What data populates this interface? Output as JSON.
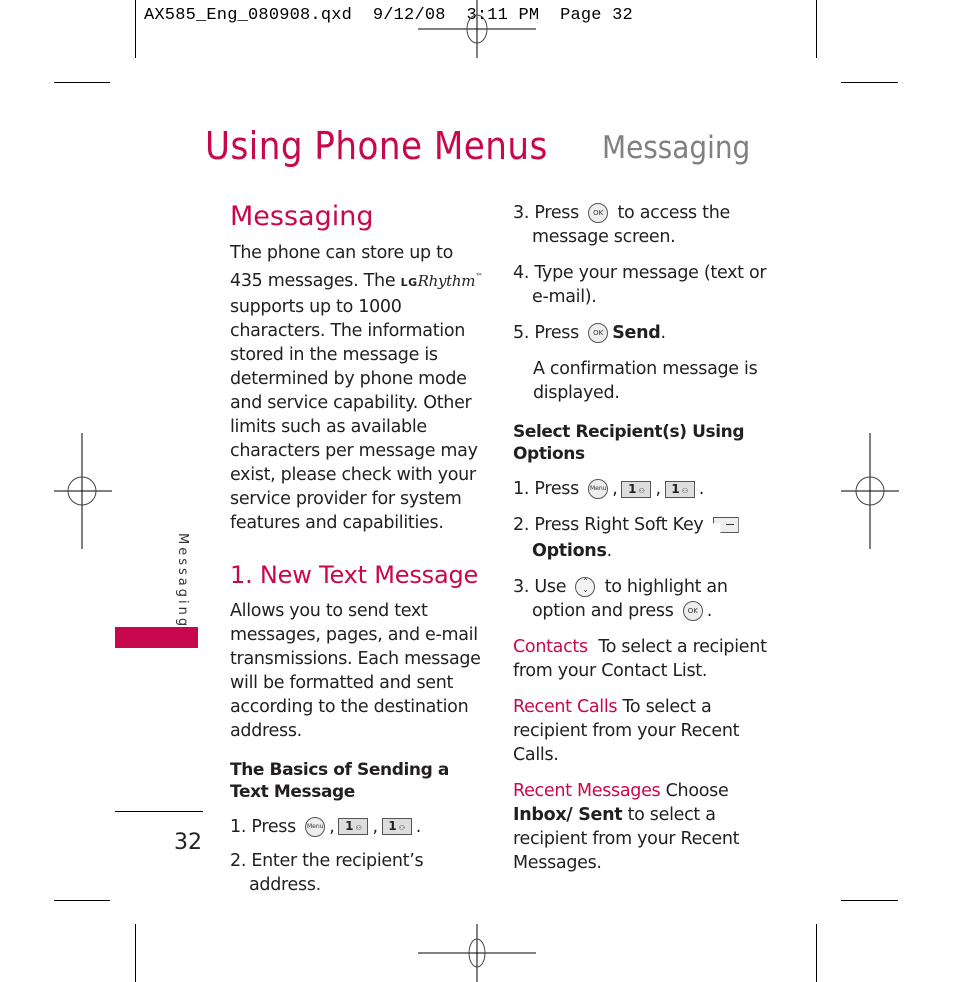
{
  "slug": "AX585_Eng_080908.qxd  9/12/08  3:11 PM  Page 32",
  "header": {
    "title": "Using Phone Menus",
    "subtitle": "Messaging"
  },
  "sidebar": {
    "label": "Messaging",
    "accent_color": "#c8084c"
  },
  "page_number": "32",
  "left_column": {
    "heading": "Messaging",
    "intro_part1": "The phone can store up to 435 messages. The",
    "brand_lg": "LG",
    "brand_name": "Rhythm",
    "brand_tm": "™",
    "intro_part2": "supports up to 1000 characters. The information stored in the message is determined by phone mode and service capability. Other limits such as available characters per message may exist, please check with your service provider for system features and capabilities.",
    "section_heading": "1. New Text Message",
    "section_text": "Allows you to send text messages, pages, and e-mail transmissions. Each message will be formatted and sent according to the destination address.",
    "basics_heading": "The Basics of Sending a Text Message",
    "steps": [
      {
        "num": "1.",
        "text": "Press",
        "keys": [
          "Menu",
          "1",
          "1"
        ],
        "end": "."
      },
      {
        "num": "2.",
        "text": "Enter the recipient’s address."
      }
    ]
  },
  "right_column": {
    "steps": [
      {
        "num": "3.",
        "before": "Press",
        "key": "OK",
        "after": "to access the message screen."
      },
      {
        "num": "4.",
        "text": "Type your message (text or e-mail)."
      },
      {
        "num": "5.",
        "before": "Press",
        "key": "OK",
        "bold": "Send",
        "after": "."
      }
    ],
    "confirmation": "A confirmation message is displayed.",
    "recipient_heading": "Select Recipient(s) Using Options",
    "recipient_steps": [
      {
        "num": "1.",
        "text": "Press",
        "keys": [
          "Menu",
          "1",
          "1"
        ],
        "end": "."
      },
      {
        "num": "2.",
        "text": "Press Right Soft Key",
        "bold": "Options",
        "end": "."
      },
      {
        "num": "3.",
        "before": "Use",
        "after": "to highlight an option and press",
        "key": "OK",
        "end": "."
      }
    ],
    "options": [
      {
        "label": "Contacts",
        "text": "To select a recipient from your Contact List."
      },
      {
        "label": "Recent Calls",
        "text": "To select a recipient from your Recent Calls."
      },
      {
        "label": "Recent Messages",
        "text_pre": "Choose",
        "bold": "Inbox/ Sent",
        "text": "to select a recipient from your Recent Messages."
      }
    ]
  },
  "key_labels": {
    "menu": "Menu",
    "ok": "OK",
    "one": "1",
    "one_sub": "⚇"
  }
}
